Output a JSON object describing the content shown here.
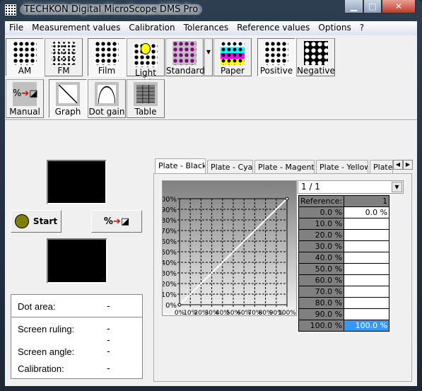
{
  "window": {
    "title": "TECHKON Digital MicroScope DMS Pro",
    "controls": [
      "minimize",
      "maximize",
      "close"
    ]
  },
  "menu": [
    "File",
    "Measurement values",
    "Calibration",
    "Tolerances",
    "Reference values",
    "Options",
    "?"
  ],
  "toolbar1": [
    {
      "label": "AM",
      "icon": "am-screen-icon",
      "active": true
    },
    {
      "label": "FM",
      "icon": "fm-screen-icon",
      "active": false
    },
    {
      "label": "Film",
      "icon": "film-icon",
      "active": true
    },
    {
      "label": "Light table",
      "icon": "light-table-icon",
      "active": false
    },
    {
      "label": "Standard",
      "icon": "standard-icon",
      "active": false
    },
    {
      "label": "Paper",
      "icon": "paper-icon",
      "active": false
    },
    {
      "label": "Positive",
      "icon": "positive-icon",
      "active": true
    },
    {
      "label": "Negative",
      "icon": "negative-icon",
      "active": false
    }
  ],
  "toolbar2": [
    {
      "label": "Manual",
      "icon": "manual-icon"
    },
    {
      "label": "Graph",
      "icon": "graph-icon",
      "active": true
    },
    {
      "label": "Dot gain",
      "icon": "dot-gain-icon"
    },
    {
      "label": "Table",
      "icon": "table-icon"
    }
  ],
  "left": {
    "start_label": "Start",
    "start_color": "#808000",
    "info": [
      {
        "label": "Dot area:",
        "value": "-"
      },
      {
        "label": "Screen ruling:",
        "value": "-"
      },
      {
        "label": "",
        "value": "-"
      },
      {
        "label": "Screen angle:",
        "value": "-"
      },
      {
        "label": "Calibration:",
        "value": "-"
      }
    ]
  },
  "tabs": [
    "Plate - Black",
    "Plate - Cyan",
    "Plate - Magenta",
    "Plate - Yellow",
    "Plate"
  ],
  "selector": "1 / 1",
  "table": {
    "header": [
      "Reference:",
      "1"
    ],
    "rows": [
      [
        "0.0 %",
        "0.0 %"
      ],
      [
        "10.0 %",
        ""
      ],
      [
        "20.0 %",
        ""
      ],
      [
        "30.0 %",
        ""
      ],
      [
        "40.0 %",
        ""
      ],
      [
        "50.0 %",
        ""
      ],
      [
        "60.0 %",
        ""
      ],
      [
        "70.0 %",
        ""
      ],
      [
        "80.0 %",
        ""
      ],
      [
        "90.0 %",
        ""
      ],
      [
        "100.0 %",
        "100.0 %"
      ]
    ],
    "selected_color": "#3399ff"
  },
  "chart_data": {
    "type": "line",
    "x": [
      0,
      100
    ],
    "y": [
      0,
      100
    ],
    "xlim": [
      0,
      100
    ],
    "ylim": [
      0,
      100
    ],
    "grid": true,
    "xticks": [
      "0%",
      "10%",
      "20%",
      "30%",
      "40%",
      "50%",
      "60%",
      "70%",
      "80%",
      "90%",
      "100%"
    ],
    "yticks": [
      "0%",
      "10%",
      "20%",
      "30%",
      "40%",
      "50%",
      "60%",
      "70%",
      "80%",
      "90%",
      "100%"
    ]
  }
}
